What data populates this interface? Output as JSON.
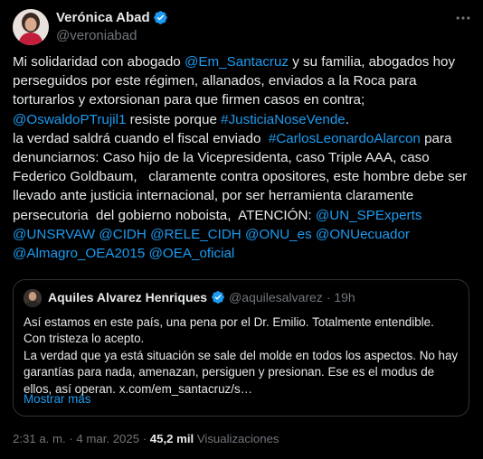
{
  "author": {
    "name": "Verónica Abad",
    "handle": "@veroniabad"
  },
  "tweet": {
    "p1": "Mi solidaridad con abogado ",
    "m1": "@Em_Santacruz",
    "p2": " y su familia, abogados hoy perseguidos por este régimen, allanados, enviados a la Roca para torturarlos y extorsionan para que firmen casos en contra;\n",
    "m2": "@OswaldoPTrujil1",
    "p3": " resiste porque ",
    "m3": "#JusticiaNoseVende",
    "p4": ".\nla verdad saldrá cuando el fiscal enviado  ",
    "m4": "#CarlosLeonardoAlarcon",
    "p5": " para denunciarnos: Caso hijo de la Vicepresidenta, caso Triple AAA, caso Federico Goldbaum,   claramente contra opositores, este hombre debe ser llevado ante justicia internacional, por ser herramienta claramente persecutoria  del gobierno noboista,  ATENCIÓN: ",
    "m5": "@UN_SPExperts",
    "sp1": "\n",
    "m6": "@UNSRVAW",
    "sp2": " ",
    "m7": "@CIDH",
    "sp3": " ",
    "m8": "@RELE_CIDH",
    "sp4": " ",
    "m9": "@ONU_es",
    "sp5": " ",
    "m10": "@ONUecuador",
    "sp6": "\n",
    "m11": "@Almagro_OEA2015",
    "sp7": " ",
    "m12": "@OEA_oficial"
  },
  "quote": {
    "name": "Aquiles Alvarez Henriques",
    "handle": "@aquilesalvarez",
    "time": "· 19h",
    "text": "Así estamos en este país, una pena por el Dr. Emilio. Totalmente entendible.\nCon tristeza lo acepto.\nLa verdad que ya está situación se sale del molde en todos los aspectos. No hay garantías para nada, amenazan, persiguen y presionan. Ese es el modus de ellos, así operan. x.com/em_santacruz/s…",
    "more_label": "Mostrar más"
  },
  "meta": {
    "time": "2:31 a. m.",
    "sep1": " · ",
    "date": "4 mar. 2025",
    "sep2": " · ",
    "views_count": "45,2 mil",
    "views_label": " Visualizaciones"
  },
  "colors": {
    "background": "#000000",
    "text": "#e7e9ea",
    "muted": "#71767b",
    "link": "#1d9bf0",
    "verified": "#1d9bf0",
    "border": "#2f3336"
  },
  "icons": {
    "verified": "verified-badge-icon",
    "more": "more-options-icon"
  }
}
